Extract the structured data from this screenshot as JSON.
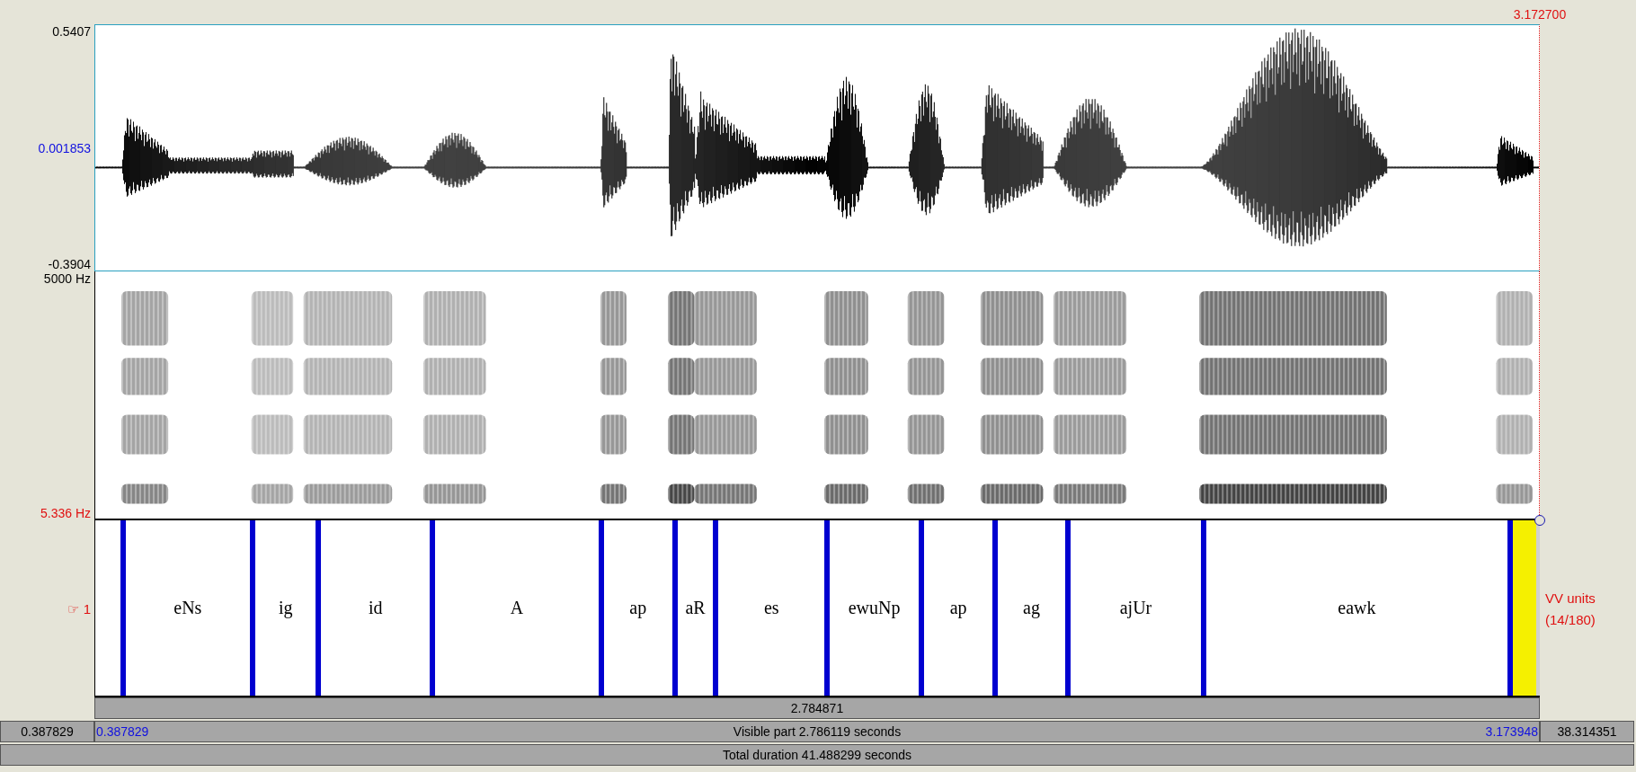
{
  "cursor_time": "3.172700",
  "waveform": {
    "max": "0.5407",
    "zero": "0.001853",
    "min": "-0.3904"
  },
  "spectrogram": {
    "max_freq": "5000 Hz",
    "min_freq": "5.336 Hz"
  },
  "tier": {
    "label": "☞ 1",
    "name": "VV units",
    "count": "(14/180)",
    "intervals": [
      {
        "label": "eNs",
        "selected": false
      },
      {
        "label": "ig",
        "selected": false
      },
      {
        "label": "id",
        "selected": false
      },
      {
        "label": "A",
        "selected": false
      },
      {
        "label": "ap",
        "selected": false
      },
      {
        "label": "aR",
        "selected": false
      },
      {
        "label": "es",
        "selected": false
      },
      {
        "label": "ewuNp",
        "selected": false
      },
      {
        "label": "ap",
        "selected": false
      },
      {
        "label": "ag",
        "selected": false
      },
      {
        "label": "ajUr",
        "selected": false
      },
      {
        "label": "eawk",
        "selected": false
      },
      {
        "selected": true
      }
    ]
  },
  "selection_bar": "2.784871",
  "visible_bar": {
    "left_outside": "0.387829",
    "start": "0.387829",
    "label": "Visible part 2.786119 seconds",
    "end": "3.173948",
    "right_outside": "38.314351"
  },
  "total_bar": "Total duration 41.488299 seconds"
}
